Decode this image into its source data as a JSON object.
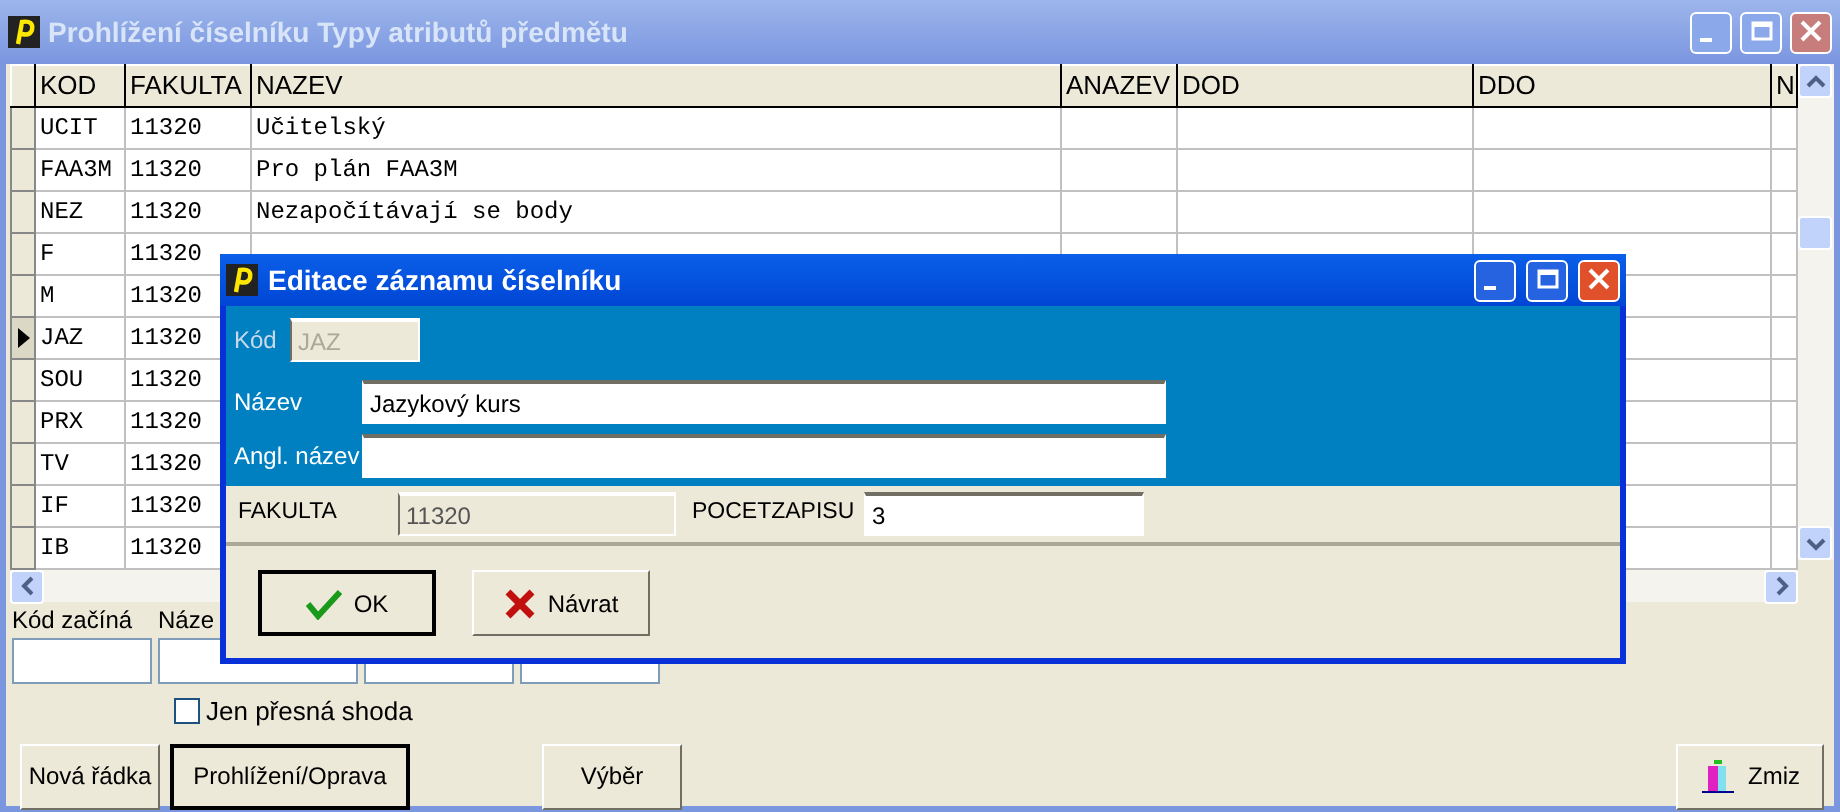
{
  "window": {
    "title": "Prohlížení číselníku Typy atributů předmětu"
  },
  "grid": {
    "columns": [
      "KOD",
      "FAKULTA",
      "NAZEV",
      "ANAZEV",
      "DOD",
      "DDO",
      "N"
    ],
    "rows": [
      {
        "cells": [
          "UCIT",
          "11320",
          "Učitelský"
        ],
        "current": false
      },
      {
        "cells": [
          "FAA3M",
          "11320",
          "Pro plán FAA3M"
        ],
        "current": false
      },
      {
        "cells": [
          "NEZ",
          "11320",
          "Nezapočítávají se body"
        ],
        "current": false
      },
      {
        "cells": [
          "F",
          "11320"
        ],
        "current": false
      },
      {
        "cells": [
          "M",
          "11320"
        ],
        "current": false
      },
      {
        "cells": [
          "JAZ",
          "11320"
        ],
        "current": true
      },
      {
        "cells": [
          "SOU",
          "11320"
        ],
        "current": false
      },
      {
        "cells": [
          "PRX",
          "11320"
        ],
        "current": false
      },
      {
        "cells": [
          "TV",
          "11320"
        ],
        "current": false
      },
      {
        "cells": [
          "IF",
          "11320"
        ],
        "current": false
      },
      {
        "cells": [
          "IB",
          "11320"
        ],
        "current": false
      }
    ]
  },
  "filter": {
    "labels": [
      "Kód začíná",
      "Náze"
    ],
    "exact_match": {
      "label": "Jen přesná shoda",
      "checked": false
    }
  },
  "buttons": [
    {
      "label": "Nová řádka",
      "kind": "plain",
      "default": false
    },
    {
      "label": "Prohlížení/Oprava",
      "kind": "plain",
      "default": true
    },
    {
      "label": "Výběr",
      "kind": "plain",
      "default": false
    },
    {
      "label": "Zmiz",
      "kind": "exit",
      "default": false
    }
  ],
  "dialog": {
    "title": "Editace záznamu číselníku",
    "fields": [
      {
        "label": "Kód",
        "value": "JAZ",
        "disabled": true
      },
      {
        "label": "Název",
        "value": "Jazykový kurs",
        "disabled": false
      },
      {
        "label": "Angl. název",
        "disabled": false
      }
    ],
    "info": [
      {
        "label": "FAKULTA",
        "value": "11320",
        "disabled": true
      },
      {
        "label": "POCETZAPISU",
        "value": "3",
        "disabled": false
      }
    ],
    "buttons": [
      {
        "label": "OK",
        "kind": "ok"
      },
      {
        "label": "Návrat",
        "kind": "cancel"
      }
    ]
  }
}
